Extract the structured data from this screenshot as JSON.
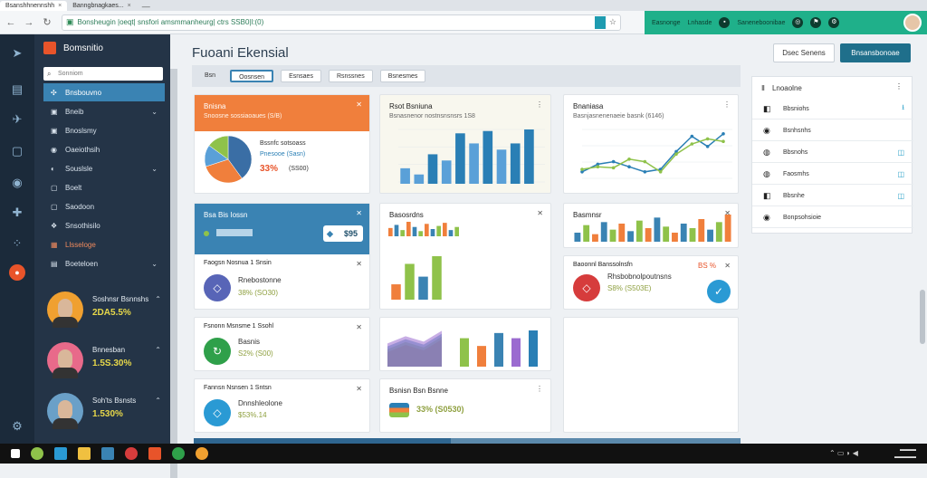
{
  "browser": {
    "tab1": "Bsanshhnennshh",
    "tab2": "Banngbnagkaes...",
    "url": "Bonsheugin |oeqt| snsfori amsmmanheurg| ctrs SSB0|l:(0)",
    "extensions": [
      "Easnonge",
      "Lnhasde",
      "Saneneboonibae"
    ]
  },
  "rail_icons": [
    "logo-icon",
    "layers-icon",
    "rocket-icon",
    "box-icon",
    "user-icon",
    "puzzle-icon",
    "grid-icon",
    "record-icon"
  ],
  "sidebar": {
    "brand": "Bomsnitio",
    "search_placeholder": "Sonniom",
    "items": [
      {
        "label": "Bnsbouvno",
        "icon": "✣",
        "active": true
      },
      {
        "label": "Bneib",
        "icon": "▣",
        "chev": "⌄"
      },
      {
        "label": "Bnoslsmy",
        "icon": "▣"
      },
      {
        "label": "Oaeiothsih",
        "icon": "◉"
      },
      {
        "label": "Souslsle",
        "icon": "◐",
        "chev": "⌄"
      },
      {
        "label": "Boelt",
        "icon": "▢"
      },
      {
        "label": "Saodoon",
        "icon": "▢"
      },
      {
        "label": "Snsothisilo",
        "icon": "❖"
      },
      {
        "label": "Llsseloge",
        "icon": "▦",
        "highlight": true
      },
      {
        "label": "Boeteloen",
        "icon": "▤",
        "chev": "⌄"
      }
    ],
    "users": [
      {
        "name": "Soshnsr Bsnnshs",
        "value": "2DA5.5%"
      },
      {
        "name": "Bnnesban",
        "value": "1.5S.30%"
      },
      {
        "name": "Soh'ts Bsnsts",
        "value": "1.530%"
      }
    ]
  },
  "main": {
    "title": "Fuoani Ekensial",
    "btn_secondary": "Dsec Senens",
    "btn_primary": "Bnsansbonoae",
    "filters": [
      "Bsn",
      "Oosnsen",
      "Esnsaes",
      "Rsnssnes",
      "Bsnesmes"
    ],
    "cards": {
      "c1": {
        "title": "Bnisna",
        "sub": "Snoosne sossiaoaues (S/B)",
        "legend1": "Bssnfc sotsoass",
        "legend2": "Pnesooe (Sasn)",
        "pct": "33%",
        "pct_sub": "(SS00)"
      },
      "c2": {
        "title": "Rsot Bsniuna",
        "sub": "Bsnasnenor nostnsnsnsrs 1S8"
      },
      "c3": {
        "title": "Bnaniasa",
        "sub": "Basnjasnenenaeie basnk (6146)"
      },
      "c4": {
        "title": "Bsa Bis Iossn",
        "value": "$95"
      },
      "c5": {
        "title": "Basosrdns"
      },
      "c6": {
        "title": "Basmnsr"
      },
      "c7": {
        "head": "Faogsn Nosnua 1 Snsin",
        "name": "Rnebostonne",
        "stat": "38% (SO30)"
      },
      "c8": {
        "head": "Baoonnl Banssolnsfn",
        "badge": "BS %",
        "name": "Rhsbobnolpoutnsns",
        "stat": "S8% (S503E)"
      },
      "c9": {
        "head": "Fsnonn Msnsme 1 Ssohl",
        "name": "Basnis",
        "stat": "S2% (S00)"
      },
      "c11": {
        "head": "Fannsn Nsnsen 1 Sntsn",
        "name": "Dnnshleolone",
        "stat": "$53%.14"
      },
      "c12": {
        "title": "Bsnisn Bsn Bsnne",
        "stat": "33% (S0530)"
      }
    },
    "right_panel": {
      "title": "Lnoaolne",
      "rows": [
        {
          "label": "Bbsniohs",
          "icon": "◧",
          "right": "⭳"
        },
        {
          "label": "Bsnhsnhs",
          "icon": "◉"
        },
        {
          "label": "Bbsnohs",
          "icon": "◍",
          "right": "◫"
        },
        {
          "label": "Faosmhs",
          "icon": "◍",
          "right": "◫"
        },
        {
          "label": "Bbsnhe",
          "icon": "◧",
          "right": "◫"
        },
        {
          "label": "Bonpsohsioie",
          "icon": "◉"
        }
      ]
    },
    "progress": 0.47
  },
  "chart_data": [
    {
      "type": "pie",
      "slices": [
        {
          "name": "",
          "value": 40,
          "color": "#3a6ea5"
        },
        {
          "name": "",
          "value": 30,
          "color": "#f07f3c"
        },
        {
          "name": "",
          "value": 15,
          "color": "#5aa0d8"
        },
        {
          "name": "",
          "value": 15,
          "color": "#8fc24a"
        }
      ]
    },
    {
      "type": "bar",
      "values": [
        20,
        12,
        38,
        30,
        65,
        52,
        68,
        44,
        52,
        70
      ],
      "colors": [
        "#5aa0d8",
        "#5aa0d8",
        "#2a7fb5",
        "#5aa0d8",
        "#2a7fb5",
        "#5aa0d8",
        "#2a7fb5",
        "#5aa0d8",
        "#2a7fb5",
        "#2a7fb5"
      ]
    },
    {
      "type": "line",
      "series": [
        {
          "values": [
            20,
            35,
            40,
            30,
            20,
            25,
            60,
            90,
            70,
            95
          ],
          "color": "#2a7fb5"
        },
        {
          "values": [
            25,
            30,
            28,
            45,
            40,
            20,
            55,
            75,
            85,
            80
          ],
          "color": "#8fc24a"
        }
      ]
    },
    {
      "type": "bar",
      "values": [
        40,
        55,
        30,
        70,
        45,
        25,
        60,
        35,
        50,
        65,
        30,
        45
      ],
      "colors": [
        "#f07f3c",
        "#3a83b3",
        "#8fc24a",
        "#f07f3c",
        "#3a83b3",
        "#8fc24a",
        "#f07f3c",
        "#3a83b3",
        "#8fc24a",
        "#f07f3c",
        "#3a83b3",
        "#8fc24a"
      ]
    },
    {
      "type": "bar",
      "values": [
        30,
        55,
        25,
        65,
        40,
        60,
        35,
        70,
        45,
        80,
        50,
        30,
        60,
        45,
        75,
        40,
        65,
        90
      ],
      "colors": [
        "#3a83b3",
        "#8fc24a",
        "#f07f3c",
        "#3a83b3",
        "#8fc24a",
        "#f07f3c"
      ]
    },
    {
      "type": "bar",
      "values": [
        30,
        70,
        45,
        85
      ],
      "colors": [
        "#f07f3c",
        "#8fc24a",
        "#3a83b3",
        "#8fc24a"
      ]
    },
    {
      "type": "area",
      "values": [
        40,
        60,
        45,
        75
      ],
      "colors": [
        "#e8542a",
        "#8fc24a",
        "#3a83b3",
        "#9b6bd0"
      ]
    },
    {
      "type": "bar",
      "values": [
        55,
        40,
        65,
        55,
        70
      ],
      "colors": [
        "#8fc24a",
        "#f07f3c",
        "#3a83b3",
        "#9b6bd0",
        "#2a7fb5"
      ]
    }
  ]
}
